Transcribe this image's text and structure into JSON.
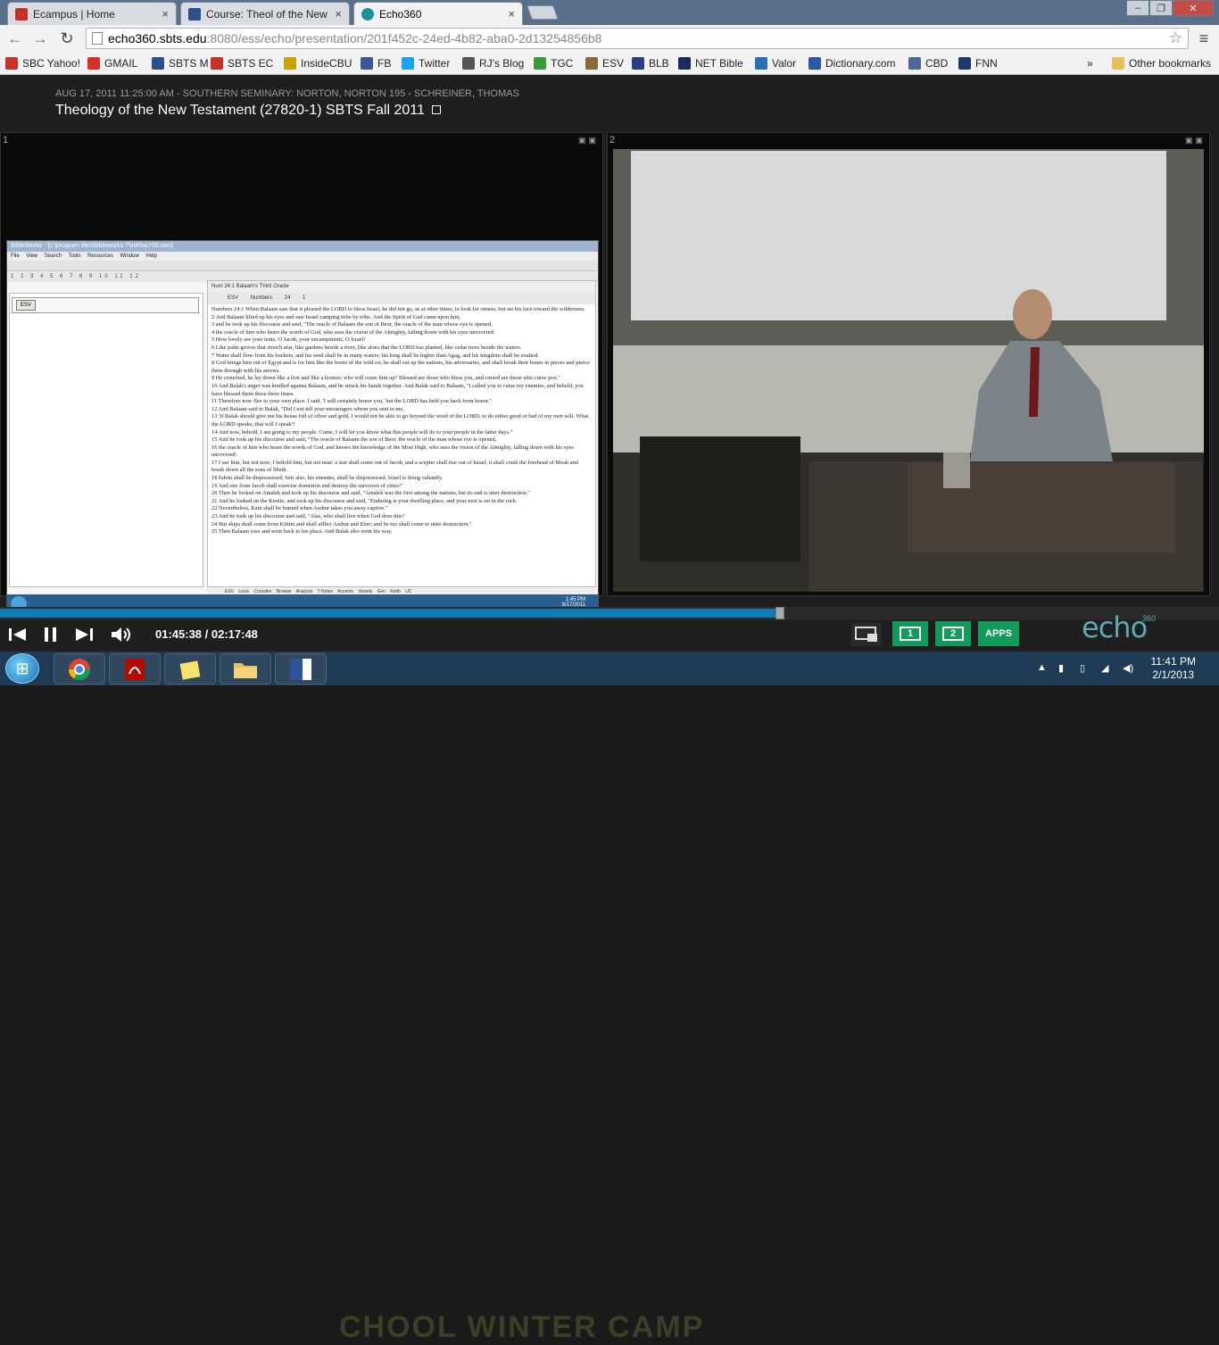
{
  "browser": {
    "tabs": [
      {
        "label": "Ecampus | Home",
        "close": "×",
        "color": "#c83228"
      },
      {
        "label": "Course: Theol of the New",
        "close": "×",
        "color": "#2c4f8c"
      },
      {
        "label": "Echo360",
        "close": "×",
        "color": "#1b8f9a"
      }
    ],
    "window_buttons": [
      "–",
      "❐",
      "✕"
    ],
    "nav": {
      "back": "←",
      "forward": "→",
      "reload": "↻",
      "star": "☆",
      "menu": "≡"
    },
    "url_host": "echo360.sbts.edu",
    "url_rest": ":8080/ess/echo/presentation/201f452c-24ed-4b82-aba0-2d13254856b8",
    "bookmarks": [
      {
        "label": "SBC Yahoo!",
        "color": "#c83228"
      },
      {
        "label": "GMAIL",
        "color": "#d93025"
      },
      {
        "label": "SBTS M",
        "color": "#2c4f8c"
      },
      {
        "label": "SBTS EC",
        "color": "#c83228"
      },
      {
        "label": "InsideCBU",
        "color": "#c9a100"
      },
      {
        "label": "FB",
        "color": "#3b5998"
      },
      {
        "label": "Twitter",
        "color": "#1da1f2"
      },
      {
        "label": "RJ's Blog",
        "color": "#555555"
      },
      {
        "label": "TGC",
        "color": "#3a9a3a"
      },
      {
        "label": "ESV",
        "color": "#8a6a3a"
      },
      {
        "label": "BLB",
        "color": "#2a3f7f"
      },
      {
        "label": "NET Bible",
        "color": "#1a2a5a"
      },
      {
        "label": "Valor",
        "color": "#2a6fb5"
      },
      {
        "label": "Dictionary.com",
        "color": "#2a5aa5"
      },
      {
        "label": "CBD",
        "color": "#4a6a9a"
      },
      {
        "label": "FNN",
        "color": "#1a3a6a"
      }
    ],
    "more": "»",
    "other_bookmarks": "Other bookmarks"
  },
  "presentation": {
    "meta": "AUG 17, 2011 11:25:00 AM - SOUTHERN SEMINARY: NORTON, NORTON 195 - SCHREINER, THOMAS",
    "title": "Theology of the New Testament (27820-1) SBTS Fall 2011",
    "panel1_label": "1",
    "panel2_label": "2"
  },
  "biblework": {
    "title": "BibleWorks - [c:\\program files\\bibleworks 7\\init\\bw700.swc]",
    "menu": "File View Search Tools Resources Window Help",
    "tabs": "1 2 3 4 5 6 7 8 9 10 11 12",
    "version": "ESV",
    "ref_header": "Num 24:1 Balaam's Third Oracle",
    "ctrl": "ESV Numbers 24 1",
    "verses": [
      "Numbers 24:1 When Balaam saw that it pleased the LORD to bless Israel, he did not go, as at other times, to look for omens, but set his face toward the wilderness.",
      "2 And Balaam lifted up his eyes and saw Israel camping tribe by tribe. And the Spirit of God came upon him,",
      "3 and he took up his discourse and said, \"The oracle of Balaam the son of Beor, the oracle of the man whose eye is opened,",
      "4 the oracle of him who hears the words of God, who sees the vision of the Almighty, falling down with his eyes uncovered:",
      "5 How lovely are your tents, O Jacob, your encampments, O Israel!",
      "6 Like palm groves that stretch afar, like gardens beside a river, like aloes that the LORD has planted, like cedar trees beside the waters.",
      "7 Water shall flow from his buckets, and his seed shall be in many waters; his king shall be higher than Agag, and his kingdom shall be exalted.",
      "8 God brings him out of Egypt and is for him like the horns of the wild ox; he shall eat up the nations, his adversaries, and shall break their bones in pieces and pierce them through with his arrows.",
      "9 He crouched, he lay down like a lion and like a lioness; who will rouse him up? Blessed are those who bless you, and cursed are those who curse you.\"",
      "10 And Balak's anger was kindled against Balaam, and he struck his hands together. And Balak said to Balaam, \"I called you to curse my enemies, and behold, you have blessed them these three times.",
      "11 Therefore now flee to your own place. I said, 'I will certainly honor you,' but the LORD has held you back from honor.\"",
      "12 And Balaam said to Balak, \"Did I not tell your messengers whom you sent to me,",
      "13 'If Balak should give me his house full of silver and gold, I would not be able to go beyond the word of the LORD, to do either good or bad of my own will. What the LORD speaks, that will I speak'?",
      "14 And now, behold, I am going to my people. Come, I will let you know what this people will do to your people in the latter days.\"",
      "15 And he took up his discourse and said, \"The oracle of Balaam the son of Beor, the oracle of the man whose eye is opened,",
      "16 the oracle of him who hears the words of God, and knows the knowledge of the Most High, who sees the vision of the Almighty, falling down with his eyes uncovered:",
      "17 I see him, but not now; I behold him, but not near: a star shall come out of Jacob, and a scepter shall rise out of Israel; it shall crush the forehead of Moab and break down all the sons of Sheth.",
      "18 Edom shall be dispossessed; Seir also, his enemies, shall be dispossessed. Israel is doing valiantly.",
      "19 And one from Jacob shall exercise dominion and destroy the survivors of cities!\"",
      "20 Then he looked on Amalek and took up his discourse and said, \"Amalek was the first among the nations, but its end is utter destruction.\"",
      "21 And he looked on the Kenite, and took up his discourse and said, \"Enduring is your dwelling place, and your nest is set in the rock.",
      "22 Nevertheless, Kain shall be burned when Asshur takes you away captive.\"",
      "23 And he took up his discourse and said, \"Alas, who shall live when God does this?",
      "24 But ships shall come from Kittim and shall afflict Asshur and Eber; and he too shall come to utter destruction.\"",
      "25 Then Balaam rose and went back to his place. And Balak also went his way."
    ],
    "bottom_tabs": "ESV Lexis Crossfire Browse Analysis T-Notes Accents Vowels Gen Ketib UC",
    "clock_time": "1:45 PM",
    "clock_date": "8/17/2011"
  },
  "controls": {
    "time": "01:45:38 / 02:17:48",
    "progress": 0.636,
    "view1": "1",
    "view2": "2",
    "apps": "APPS",
    "logo": "echo",
    "logo_sup": "360",
    "accent": "#139b5b",
    "progress_color": "#0f7cb3"
  },
  "taskbar": {
    "apps": [
      "chrome",
      "acrobat",
      "sticky-notes",
      "explorer",
      "word"
    ],
    "clock_time": "11:41 PM",
    "clock_date": "2/1/2013",
    "wallpaper_text": "CHOOL WINTER CAMP"
  }
}
